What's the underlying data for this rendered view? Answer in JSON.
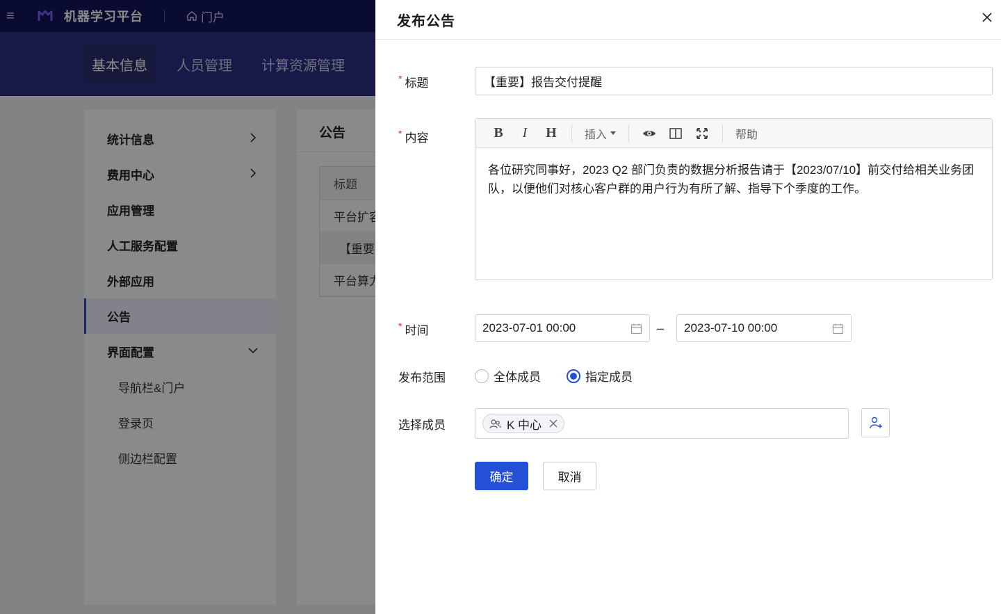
{
  "app": {
    "title": "机器学习平台",
    "portal_label": "门户",
    "tabs": [
      "基本信息",
      "人员管理",
      "计算资源管理"
    ]
  },
  "sidebar": {
    "items": [
      {
        "label": "统计信息"
      },
      {
        "label": "费用中心"
      },
      {
        "label": "应用管理"
      },
      {
        "label": "人工服务配置"
      },
      {
        "label": "外部应用"
      },
      {
        "label": "公告"
      },
      {
        "label": "界面配置"
      }
    ],
    "sub_items": [
      {
        "label": "导航栏&门户"
      },
      {
        "label": "登录页"
      },
      {
        "label": "侧边栏配置"
      }
    ]
  },
  "notice_card": {
    "title": "公告",
    "table_header": "标题",
    "rows": [
      "平台扩容",
      "【重要】",
      "平台算力"
    ]
  },
  "drawer": {
    "title": "发布公告",
    "fields": {
      "title_label": "标题",
      "title_value": "【重要】报告交付提醒",
      "content_label": "内容",
      "time_label": "时间",
      "scope_label": "发布范围",
      "members_label": "选择成员"
    },
    "editor": {
      "toolbar": {
        "bold": "B",
        "italic": "I",
        "heading": "H",
        "insert": "插入",
        "help": "帮助"
      },
      "content": "各位研究同事好，2023 Q2 部门负责的数据分析报告请于【2023/07/10】前交付给相关业务团队，以便他们对核心客户群的用户行为有所了解、指导下个季度的工作。"
    },
    "time_range": {
      "start": "2023-07-01 00:00",
      "separator": "–",
      "end": "2023-07-10 00:00"
    },
    "scope": {
      "options": [
        {
          "label": "全体成员",
          "checked": false
        },
        {
          "label": "指定成员",
          "checked": true
        }
      ]
    },
    "members": {
      "tags": [
        {
          "label": "K 中心",
          "icon": "user-group-icon"
        }
      ]
    },
    "buttons": {
      "confirm": "确定",
      "cancel": "取消"
    }
  },
  "colors": {
    "topbar": "#14165a",
    "subnav": "#2c2f82",
    "primary": "#2450d8",
    "required": "#e0242e"
  }
}
